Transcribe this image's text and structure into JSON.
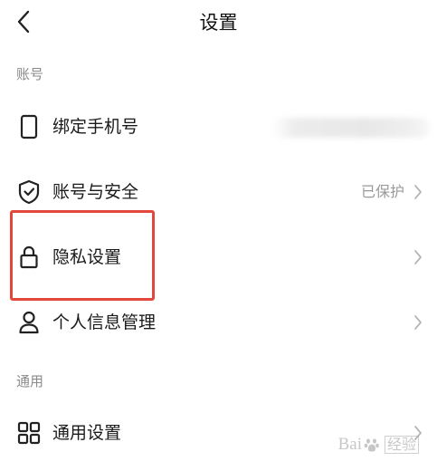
{
  "header": {
    "title": "设置",
    "back_icon": "chevron-left-icon"
  },
  "sections": {
    "account": {
      "label": "账号",
      "items": [
        {
          "label": "绑定手机号",
          "icon": "phone-icon",
          "value": ""
        },
        {
          "label": "账号与安全",
          "icon": "shield-check-icon",
          "value": "已保护"
        },
        {
          "label": "隐私设置",
          "icon": "lock-icon",
          "value": ""
        },
        {
          "label": "个人信息管理",
          "icon": "person-icon",
          "value": ""
        }
      ]
    },
    "general": {
      "label": "通用",
      "items": [
        {
          "label": "通用设置",
          "icon": "grid-icon",
          "value": ""
        }
      ]
    }
  },
  "watermark": {
    "text_left": "Bai",
    "text_right": "经验"
  },
  "colors": {
    "highlight": "#e2473b",
    "secondary_text": "#9a9a9a",
    "section_label": "#8a8a8a"
  }
}
